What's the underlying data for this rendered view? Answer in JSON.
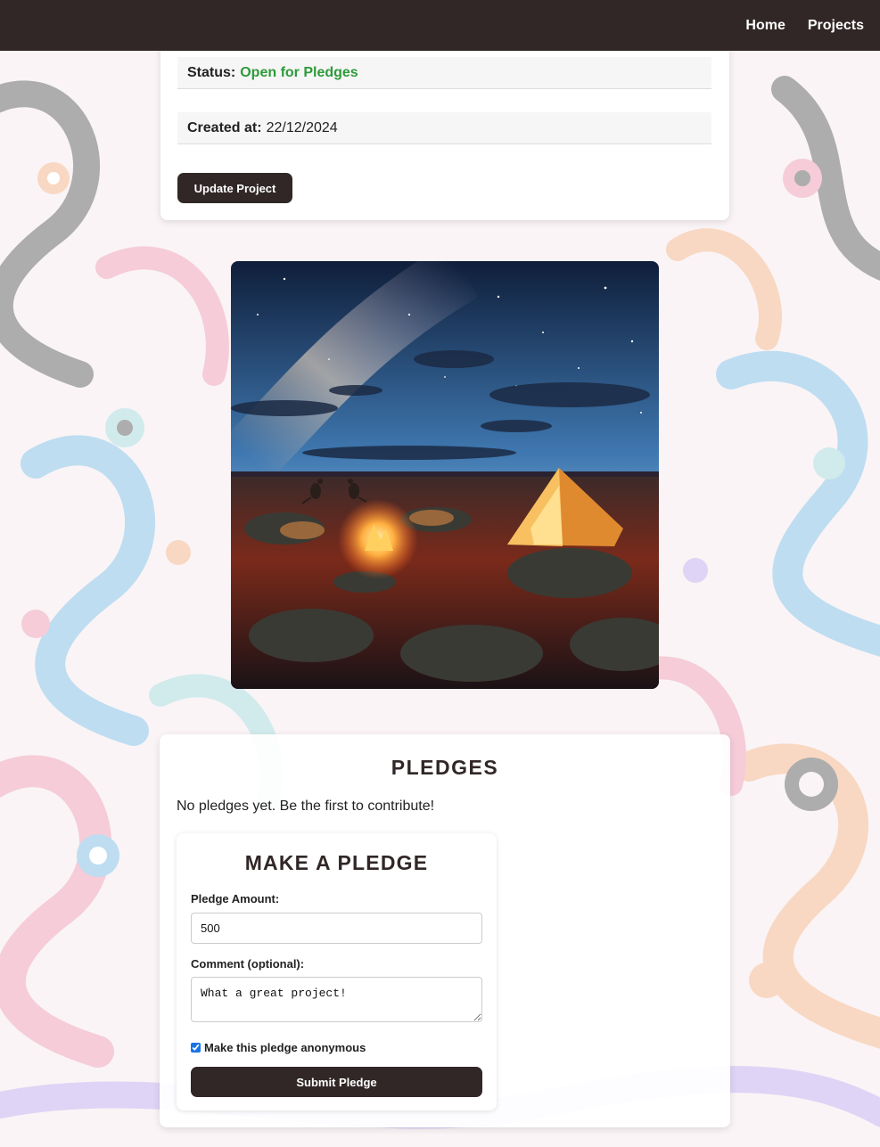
{
  "nav": {
    "home": "Home",
    "projects": "Projects"
  },
  "project_details": {
    "status_label": "Status:",
    "status_value": "Open for Pledges",
    "status_color": "#2e9a3a",
    "created_label": "Created at:",
    "created_value": "22/12/2024",
    "update_button": "Update Project"
  },
  "project_image": {
    "alt": "Campfire and glowing tent beneath the Milky Way in the outback, with kangaroos"
  },
  "pledges": {
    "title": "PLEDGES",
    "empty_message": "No pledges yet. Be the first to contribute!",
    "form": {
      "title": "MAKE A PLEDGE",
      "amount_label": "Pledge Amount:",
      "amount_value": "500",
      "comment_label": "Comment (optional):",
      "comment_value": "What a great project!",
      "anonymous_label": "Make this pledge anonymous",
      "anonymous_checked": true,
      "submit_button": "Submit Pledge"
    }
  },
  "colors": {
    "navbar": "#312727",
    "button": "#312727",
    "accent_green": "#2e9a3a"
  }
}
